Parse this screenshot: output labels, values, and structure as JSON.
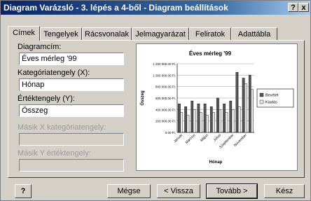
{
  "window": {
    "title": "Diagram Varázsló - 3. lépés a 4-ből - Diagram beállítások",
    "help": "?",
    "close": "x"
  },
  "tabs": [
    {
      "label": "Címek",
      "active": true
    },
    {
      "label": "Tengelyek"
    },
    {
      "label": "Rácsvonalak"
    },
    {
      "label": "Jelmagyarázat"
    },
    {
      "label": "Feliratok"
    },
    {
      "label": "Adattábla"
    }
  ],
  "form": {
    "chart_title_label": "Diagramcím:",
    "chart_title_value": "Éves mérleg '99",
    "category_axis_label": "Kategóriatengely (X):",
    "category_axis_value": "Hónap",
    "value_axis_label": "Értéktengely (Y):",
    "value_axis_value": "Összeg",
    "second_x_label": "Másik X kategóriatengely:",
    "second_x_value": "",
    "second_y_label": "Másik Y értéktengely:",
    "second_y_value": ""
  },
  "buttons": {
    "help_icon": "?",
    "cancel": "Mégse",
    "back": "< Vissza",
    "next": "Tovább >",
    "finish": "Kész"
  },
  "chart_data": {
    "type": "bar",
    "title": "Éves mérleg '99",
    "xlabel": "Hónap",
    "ylabel": "Összeg",
    "categories": [
      "Január",
      "Február",
      "Március",
      "Április",
      "Május",
      "Június",
      "Július",
      "Augusztus",
      "Szeptember",
      "Október",
      "November",
      "December"
    ],
    "x_tick_labels": [
      "Január",
      "Március",
      "Május",
      "Július",
      "Szeptember",
      "November"
    ],
    "ylim": [
      0,
      1200000
    ],
    "y_ticks": [
      "1 200 000.00 Ft.",
      "1 000 000.00 Ft.",
      "800 000.00 Ft.",
      "600 000.00 Ft.",
      "400 000.00 Ft.",
      "200 000.00 Ft.",
      "0.00 Ft."
    ],
    "series": [
      {
        "name": "Bevétel",
        "values": [
          500000,
          450000,
          550000,
          500000,
          500000,
          450000,
          600000,
          500000,
          550000,
          1050000,
          950000,
          1000000
        ]
      },
      {
        "name": "Kiadás",
        "values": [
          350000,
          300000,
          400000,
          350000,
          300000,
          350000,
          400000,
          350000,
          400000,
          450000,
          850000,
          750000
        ]
      }
    ],
    "colors": {
      "Bevétel": "#555555",
      "Kiadás": "#e8e8e8"
    },
    "legend_position": "right",
    "grid": true
  }
}
